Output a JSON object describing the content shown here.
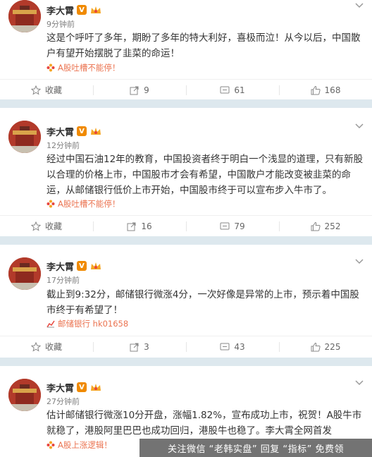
{
  "user": {
    "name": "李大霄",
    "vip": "V"
  },
  "posts": [
    {
      "time": "9分钟前",
      "text": "这是个呼吁了多年，期盼了多年的特大利好，喜极而泣！从今以后，中国散户有望开始摆脱了韭菜的命运！",
      "tag": "A股吐槽不能停！",
      "collect": "收藏",
      "repost": "9",
      "comment": "61",
      "like": "168"
    },
    {
      "time": "12分钟前",
      "text": "经过中国石油12年的教育，中国投资者终于明白一个浅显的道理，只有新股以合理的价格上市，中国股市才会有希望，中国散户才能改变被韭菜的命运，从邮储银行低价上市开始，中国股市终于可以宣布步入牛市了。",
      "tag": "A股吐槽不能停！",
      "collect": "收藏",
      "repost": "16",
      "comment": "79",
      "like": "252"
    },
    {
      "time": "17分钟前",
      "text": "截止到9:32分，邮储银行微涨4分，一次好像是异常的上市，预示着中国股市终于有希望了！",
      "tag": "邮储银行 hk01658",
      "collect": "收藏",
      "repost": "3",
      "comment": "43",
      "like": "225"
    },
    {
      "time": "27分钟前",
      "text": "估计邮储银行微涨10分开盘，涨幅1.82%，宣布成功上市，祝贺！A股牛市就稳了，港股阿里巴巴也成功回归，港股牛也稳了。李大霄全网首发",
      "tag": "A股上涨逻辑！"
    }
  ],
  "watermark": "关注微信 “老韩实盘” 回复 “指标” 免费领"
}
